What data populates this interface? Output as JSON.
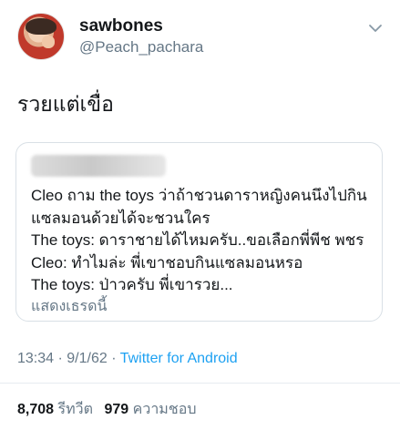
{
  "tweet": {
    "author": {
      "display_name": "sawbones",
      "handle": "@Peach_pachara"
    },
    "text": "รวยแต่เขื่อ",
    "more_icon": "chevron-down-icon",
    "quoted": {
      "lines": [
        "Cleo ถาม the toys ว่าถ้าชวนดาราหญิงคนนึงไปกิน",
        "แซลมอนด้วยได้จะชวนใคร",
        "The toys: ดาราชายได้ไหมครับ..ขอเลือกพี่พีช พชร",
        "Cleo: ทำไมล่ะ พี่เขาชอบกินแซลมอนหรอ",
        "The toys: ป่าวครับ พี่เขารวย..."
      ],
      "show_thread": "แสดงเธรดนี้"
    },
    "meta": {
      "time": "13:34",
      "separator1": " · ",
      "date": "9/1/62",
      "separator2": " · ",
      "source": "Twitter for Android"
    },
    "stats": {
      "retweets": "8,708",
      "retweets_label": "รีทวีต",
      "likes": "979",
      "likes_label": "ความชอบ"
    }
  }
}
